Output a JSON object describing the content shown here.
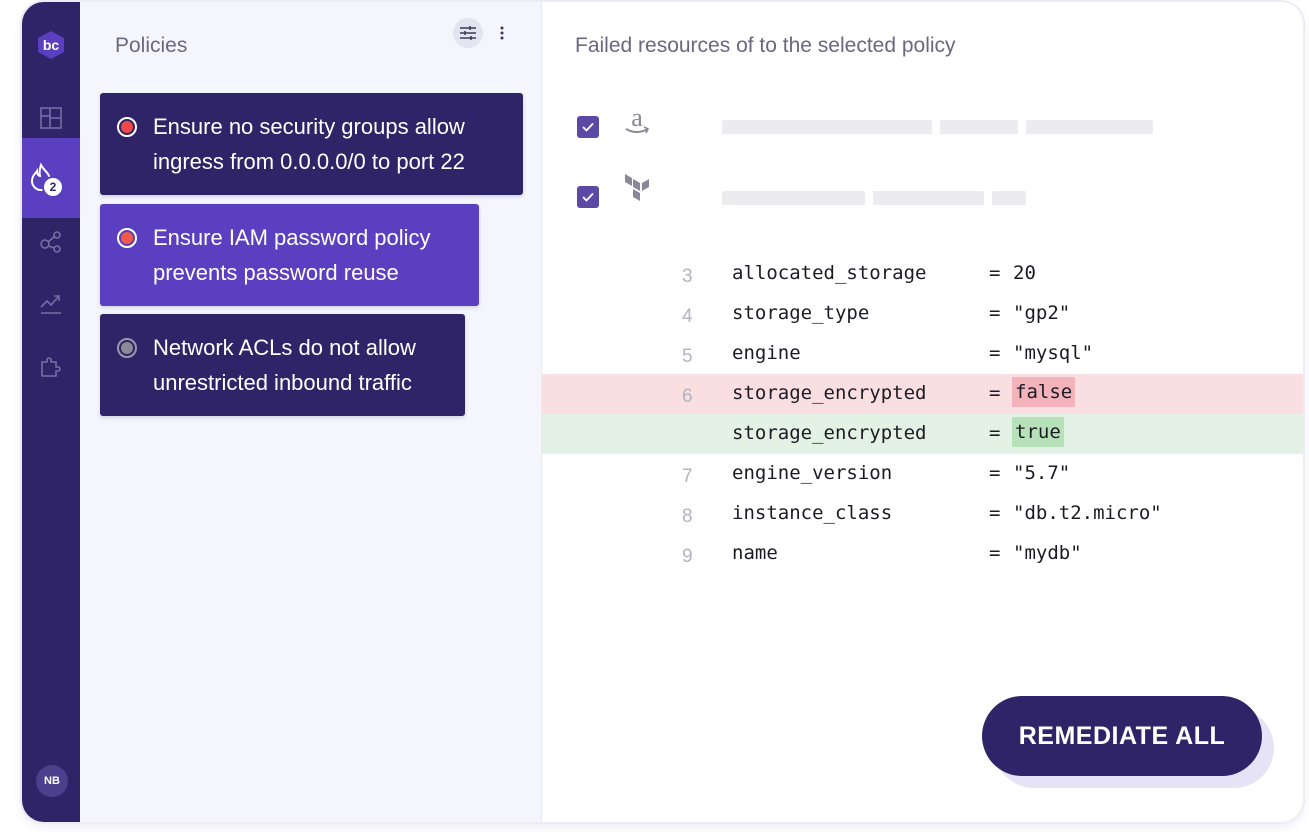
{
  "sidebar": {
    "logo_text": "bc",
    "active_badge": "2",
    "avatar_initials": "NB",
    "items": [
      {
        "icon": "dashboard-icon"
      },
      {
        "icon": "fire-icon"
      },
      {
        "icon": "graph-icon"
      },
      {
        "icon": "trend-icon"
      },
      {
        "icon": "puzzle-icon"
      }
    ]
  },
  "policies": {
    "title": "Policies",
    "items": [
      {
        "line1": "Ensure no security groups allow",
        "line2": "ingress from 0.0.0.0/0 to port 22",
        "status": "failed",
        "bg": "#2f2468",
        "dot": "#f04848"
      },
      {
        "line1": "Ensure IAM password policy",
        "line2": "prevents password reuse",
        "status": "failed-selected",
        "bg": "#5a3fc0",
        "dot": "#f05a48"
      },
      {
        "line1": "Network ACLs do not allow",
        "line2": "unrestricted inbound traffic",
        "status": "neutral",
        "bg": "#2f2468",
        "dot": "#8a8a96"
      }
    ]
  },
  "code_panel": {
    "title": "Failed resources of to the selected policy",
    "resources": [
      {
        "provider_icon": "amazon-icon",
        "checked": true
      },
      {
        "provider_icon": "terraform-icon",
        "checked": true
      }
    ],
    "lines": [
      {
        "num": "3",
        "key": "allocated_storage",
        "eq": "=",
        "value": "20",
        "kind": "normal"
      },
      {
        "num": "4",
        "key": "storage_type",
        "eq": "=",
        "value": "\"gp2\"",
        "kind": "normal"
      },
      {
        "num": "5",
        "key": "engine",
        "eq": "=",
        "value": "\"mysql\"",
        "kind": "normal"
      },
      {
        "num": "6",
        "key": "storage_encrypted",
        "eq": "=",
        "value": "false",
        "kind": "removed"
      },
      {
        "num": "",
        "key": "storage_encrypted",
        "eq": "=",
        "value": "true",
        "kind": "added"
      },
      {
        "num": "7",
        "key": "engine_version",
        "eq": "=",
        "value": "\"5.7\"",
        "kind": "normal"
      },
      {
        "num": "8",
        "key": "instance_class",
        "eq": "=",
        "value": "\"db.t2.micro\"",
        "kind": "normal"
      },
      {
        "num": "9",
        "key": "name",
        "eq": "=",
        "value": "\"mydb\"",
        "kind": "normal"
      }
    ],
    "remediate_label": "REMEDIATE ALL"
  },
  "colors": {
    "sidebar": "#2f2468",
    "accent": "#5a3fc0",
    "removed_bg": "#fadfe2",
    "added_bg": "#e3f2e4"
  }
}
